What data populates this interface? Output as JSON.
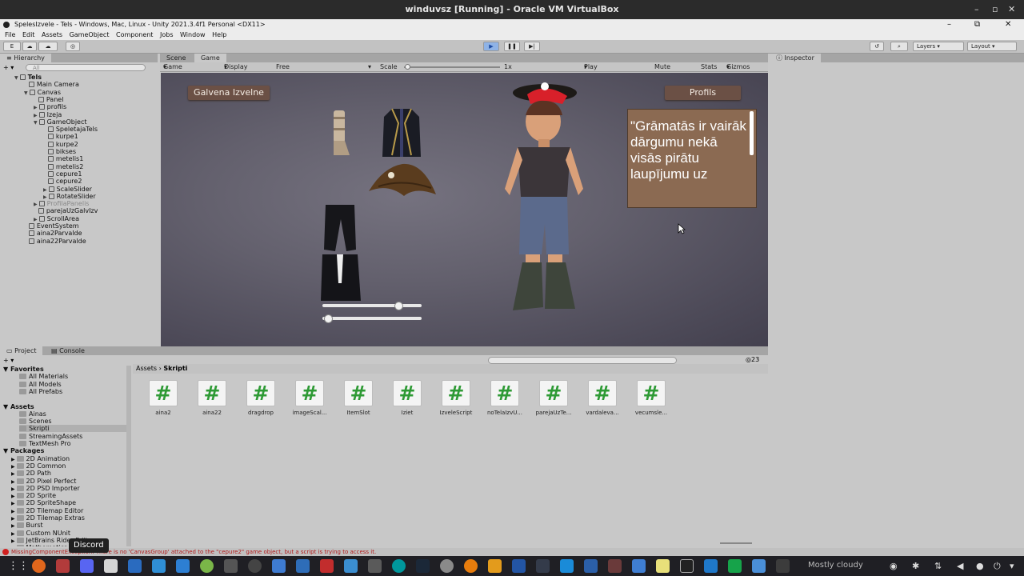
{
  "vbox": {
    "title": "winduvsz [Running] - Oracle VM VirtualBox"
  },
  "unity": {
    "title": "SpelesIzvele - Tels - Windows, Mac, Linux - Unity 2021.3.4f1 Personal <DX11>",
    "menu": [
      "File",
      "Edit",
      "Assets",
      "GameObject",
      "Component",
      "Jobs",
      "Window",
      "Help"
    ],
    "toolbar": {
      "account": "E",
      "layers": "Layers",
      "layout": "Layout"
    }
  },
  "hierarchy": {
    "tab": "Hierarchy",
    "search_placeholder": "All",
    "rows": [
      {
        "label": "Tels",
        "indent": 0,
        "style": "bold",
        "arrow": "▼"
      },
      {
        "label": "Main Camera",
        "indent": 1
      },
      {
        "label": "Canvas",
        "indent": 1,
        "arrow": "▼"
      },
      {
        "label": "Panel",
        "indent": 2
      },
      {
        "label": "profils",
        "indent": 2,
        "arrow": "▶"
      },
      {
        "label": "Izeja",
        "indent": 2,
        "arrow": "▶"
      },
      {
        "label": "GameObject",
        "indent": 2,
        "arrow": "▼"
      },
      {
        "label": "SpeletajaTels",
        "indent": 3
      },
      {
        "label": "kurpe1",
        "indent": 3
      },
      {
        "label": "kurpe2",
        "indent": 3
      },
      {
        "label": "bikses",
        "indent": 3
      },
      {
        "label": "metelis1",
        "indent": 3
      },
      {
        "label": "metelis2",
        "indent": 3
      },
      {
        "label": "cepure1",
        "indent": 3
      },
      {
        "label": "cepure2",
        "indent": 3
      },
      {
        "label": "ScaleSlider",
        "indent": 3,
        "arrow": "▶"
      },
      {
        "label": "RotateSlider",
        "indent": 3,
        "arrow": "▶"
      },
      {
        "label": "ProfilaPanelis",
        "indent": 2,
        "style": "dim",
        "arrow": "▶"
      },
      {
        "label": "parejaUzGalvIzv",
        "indent": 2
      },
      {
        "label": "ScrollArea",
        "indent": 2,
        "arrow": "▶"
      },
      {
        "label": "EventSystem",
        "indent": 1
      },
      {
        "label": "aina2Parvalde",
        "indent": 1
      },
      {
        "label": "aina22Parvalde",
        "indent": 1
      }
    ]
  },
  "game": {
    "tabs": [
      "Scene",
      "Game"
    ],
    "options": {
      "mode": "Game",
      "display": "Display 1",
      "aspect": "Free Aspect",
      "scale_label": "Scale",
      "scale_value": "1x",
      "play_focused": "Play Focused",
      "mute": "Mute Audio",
      "stats": "Stats",
      "gizmos": "Gizmos"
    },
    "main_button": "Galvena Izvelne",
    "profile_button": "Profils",
    "quote": "\"Grāmatās ir vairāk dārgumu nekā visās pirātu laupījumu uz",
    "sliders": {
      "scale": 0.78,
      "rotate": 0.03
    }
  },
  "inspector": {
    "tab": "Inspector"
  },
  "project": {
    "tabs": [
      "Project",
      "Console"
    ],
    "favorites_label": "Favorites",
    "favorites": [
      "All Materials",
      "All Models",
      "All Prefabs"
    ],
    "assets_label": "Assets",
    "assets": [
      "Ainas",
      "Scenes",
      "Skripti",
      "StreamingAssets",
      "TextMesh Pro"
    ],
    "packages_label": "Packages",
    "packages": [
      "2D Animation",
      "2D Common",
      "2D Path",
      "2D Pixel Perfect",
      "2D PSD Importer",
      "2D Sprite",
      "2D SpriteShape",
      "2D Tilemap Editor",
      "2D Tilemap Extras",
      "Burst",
      "Custom NUnit",
      "JetBrains Rider Editor",
      "Mathematics"
    ],
    "breadcrumb_root": "Assets",
    "breadcrumb_current": "Skripti",
    "item_count": "23",
    "files": [
      "aina2",
      "aina22",
      "dragdrop",
      "imageScal...",
      "ItemSlot",
      "Iziet",
      "IzveleScript",
      "noTelaIzvU...",
      "parejaUzTe...",
      "vardaleva...",
      "vecumsle..."
    ]
  },
  "status": {
    "message": "MissingComponentException: There is no 'CanvasGroup' attached to the \"cepure2\" game object, but a script is trying to access it."
  },
  "taskbar": {
    "tooltip": "Discord",
    "weather": "Mostly cloudy"
  }
}
